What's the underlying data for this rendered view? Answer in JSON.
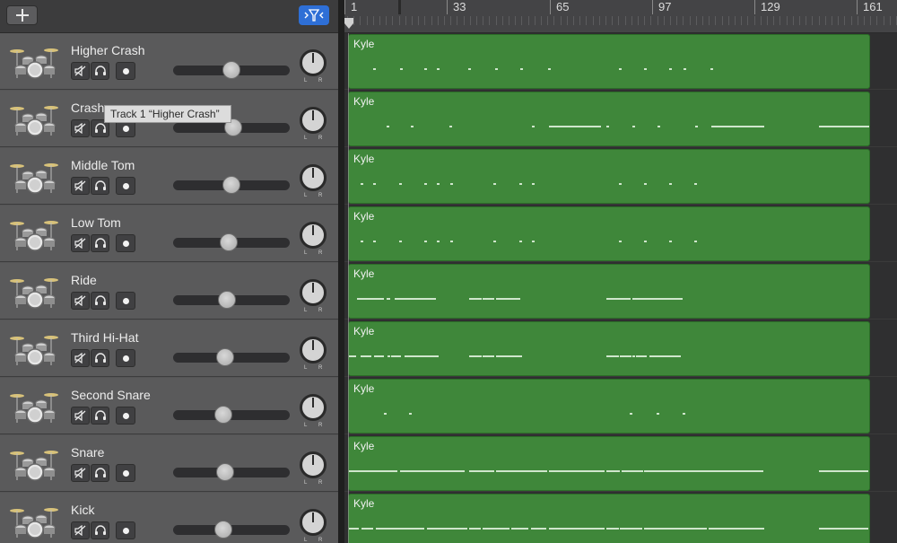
{
  "toolbar": {
    "add_icon": "plus-icon",
    "filter_icon": "catch-filter-icon"
  },
  "ruler": {
    "labels": [
      "1",
      "33",
      "65",
      "97",
      "129",
      "161"
    ]
  },
  "tooltip": {
    "text": "Track 1 “Higher Crash”"
  },
  "pan": {
    "left_label": "L",
    "right_label": "R"
  },
  "colors": {
    "region": "#3f873a",
    "accent": "#2e6fd6",
    "header": "#5a5a5b"
  },
  "tracks": [
    {
      "name": "Higher Crash",
      "volume": 0.5,
      "region": "Kyle"
    },
    {
      "name": "Crash",
      "volume": 0.52,
      "region": "Kyle"
    },
    {
      "name": "Middle Tom",
      "volume": 0.5,
      "region": "Kyle"
    },
    {
      "name": "Low Tom",
      "volume": 0.47,
      "region": "Kyle"
    },
    {
      "name": "Ride",
      "volume": 0.45,
      "region": "Kyle"
    },
    {
      "name": "Third Hi-Hat",
      "volume": 0.44,
      "region": "Kyle"
    },
    {
      "name": "Second Snare",
      "volume": 0.42,
      "region": "Kyle"
    },
    {
      "name": "Snare",
      "volume": 0.44,
      "region": "Kyle"
    },
    {
      "name": "Kick",
      "volume": 0.42,
      "region": "Kyle"
    }
  ]
}
